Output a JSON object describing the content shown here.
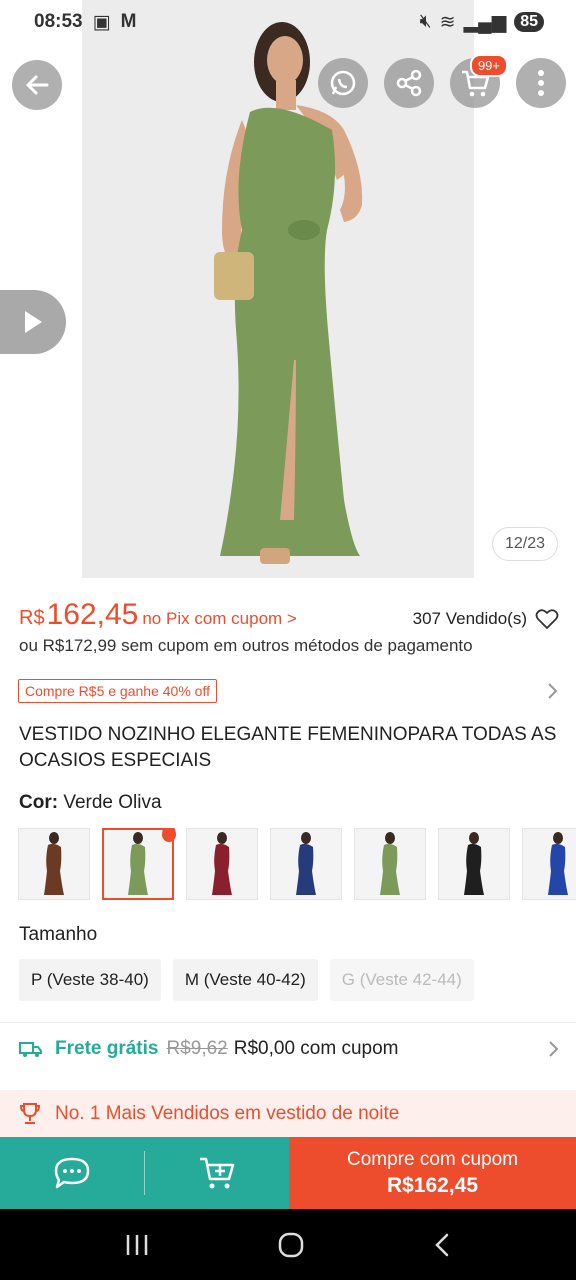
{
  "status_bar": {
    "time": "08:53",
    "carrier_icon": "M",
    "battery": "85"
  },
  "hero": {
    "image_counter": "12/23",
    "cart_badge": "99+"
  },
  "price": {
    "currency": "R$",
    "value": "162,45",
    "pix_label": "no Pix com cupom >",
    "sold": "307 Vendido(s)",
    "alt_price": "ou R$172,99 sem cupom em outros métodos de pagamento"
  },
  "promo": {
    "label": "Compre R$5 e ganhe 40% off"
  },
  "product": {
    "title": "VESTIDO NOZINHO ELEGANTE FEMENINOPARA TODAS AS OCASIOS ESPECIAIS"
  },
  "color": {
    "label": "Cor:",
    "value": "Verde Oliva"
  },
  "variant_colors": [
    "#6b3a25",
    "#7c9a5a",
    "#8a1f2e",
    "#253b7a",
    "#7c9a5a",
    "#1f1f1f",
    "#2346a8"
  ],
  "size": {
    "label": "Tamanho",
    "options": [
      "P (Veste 38-40)",
      "M (Veste 40-42)",
      "G (Veste 42-44)"
    ]
  },
  "shipping": {
    "free": "Frete grátis",
    "old_price": "R$9,62",
    "new_price": "R$0,00 com cupom"
  },
  "bestseller": {
    "label": "No. 1 Mais Vendidos em vestido de noite"
  },
  "action": {
    "buy_line1": "Compre com cupom",
    "buy_line2": "R$162,45"
  },
  "colors": {
    "accent": "#ee4d2d",
    "teal": "#26aa99",
    "dress": "#7c9a5a"
  }
}
